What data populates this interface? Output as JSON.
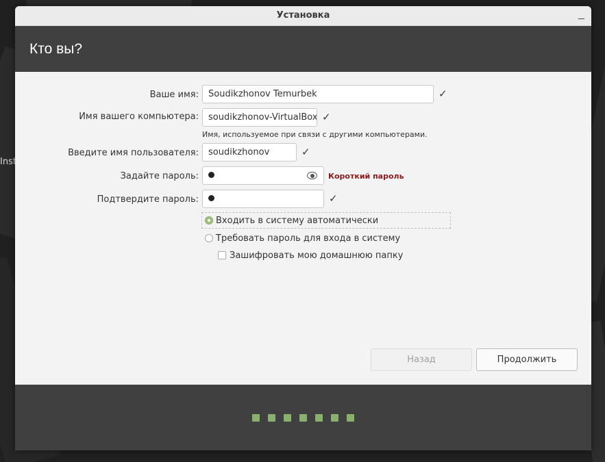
{
  "desktop": {
    "label": "Inst"
  },
  "window": {
    "title": "Установка"
  },
  "header": {
    "title": "Кто вы?"
  },
  "form": {
    "name_label": "Ваше имя:",
    "name_value": "Soudikzhonov Temurbek",
    "computer_label": "Имя вашего компьютера:",
    "computer_value": "soudikzhonov-VirtualBox",
    "computer_hint": "Имя, используемое при связи с другими компьютерами.",
    "username_label": "Введите имя пользователя:",
    "username_value": "soudikzhonov",
    "password_label": "Задайте пароль:",
    "password_strength": "Короткий пароль",
    "confirm_label": "Подтвердите пароль:",
    "check_glyph": "✓",
    "autologin_label": "Входить в систему автоматически",
    "autologin_selected": true,
    "require_password_label": "Требовать пароль для входа в систему",
    "require_password_selected": false,
    "encrypt_home_label": "Зашифровать мою домашнюю папку",
    "encrypt_home_checked": false
  },
  "buttons": {
    "back": "Назад",
    "continue": "Продолжить"
  },
  "progress": {
    "total_steps": 7
  },
  "colors": {
    "accent": "#8ab06f",
    "header": "#404040",
    "warning": "#8b1a1a"
  }
}
